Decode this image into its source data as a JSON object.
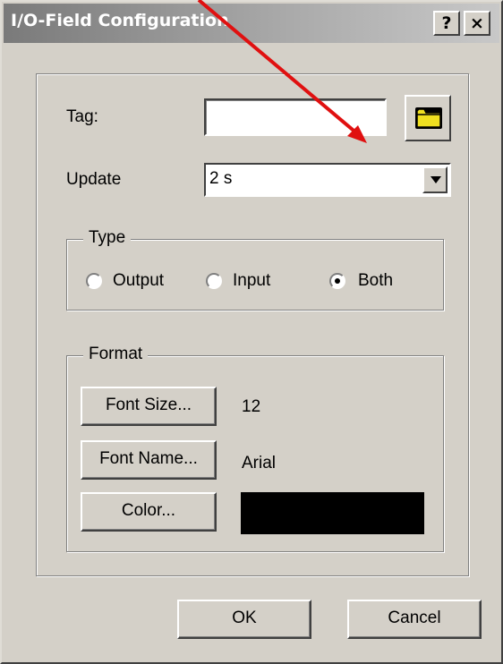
{
  "window": {
    "title": "I/O-Field Configuration",
    "help_label": "?",
    "close_label": "×"
  },
  "tag": {
    "label": "Tag:",
    "value": ""
  },
  "update": {
    "label": "Update",
    "value": "2 s"
  },
  "type_group": {
    "legend": "Type",
    "options": [
      {
        "label": "Output",
        "selected": false
      },
      {
        "label": "Input",
        "selected": false
      },
      {
        "label": "Both",
        "selected": true
      }
    ]
  },
  "format_group": {
    "legend": "Format",
    "font_size_button": "Font Size...",
    "font_size_value": "12",
    "font_name_button": "Font Name...",
    "font_name_value": "Arial",
    "color_button": "Color...",
    "color_value": "#000000"
  },
  "buttons": {
    "ok": "OK",
    "cancel": "Cancel"
  },
  "annotation": {
    "arrow_color": "#e01010"
  },
  "icons": {
    "browse": "folder-icon",
    "dropdown": "chevron-down-icon"
  }
}
